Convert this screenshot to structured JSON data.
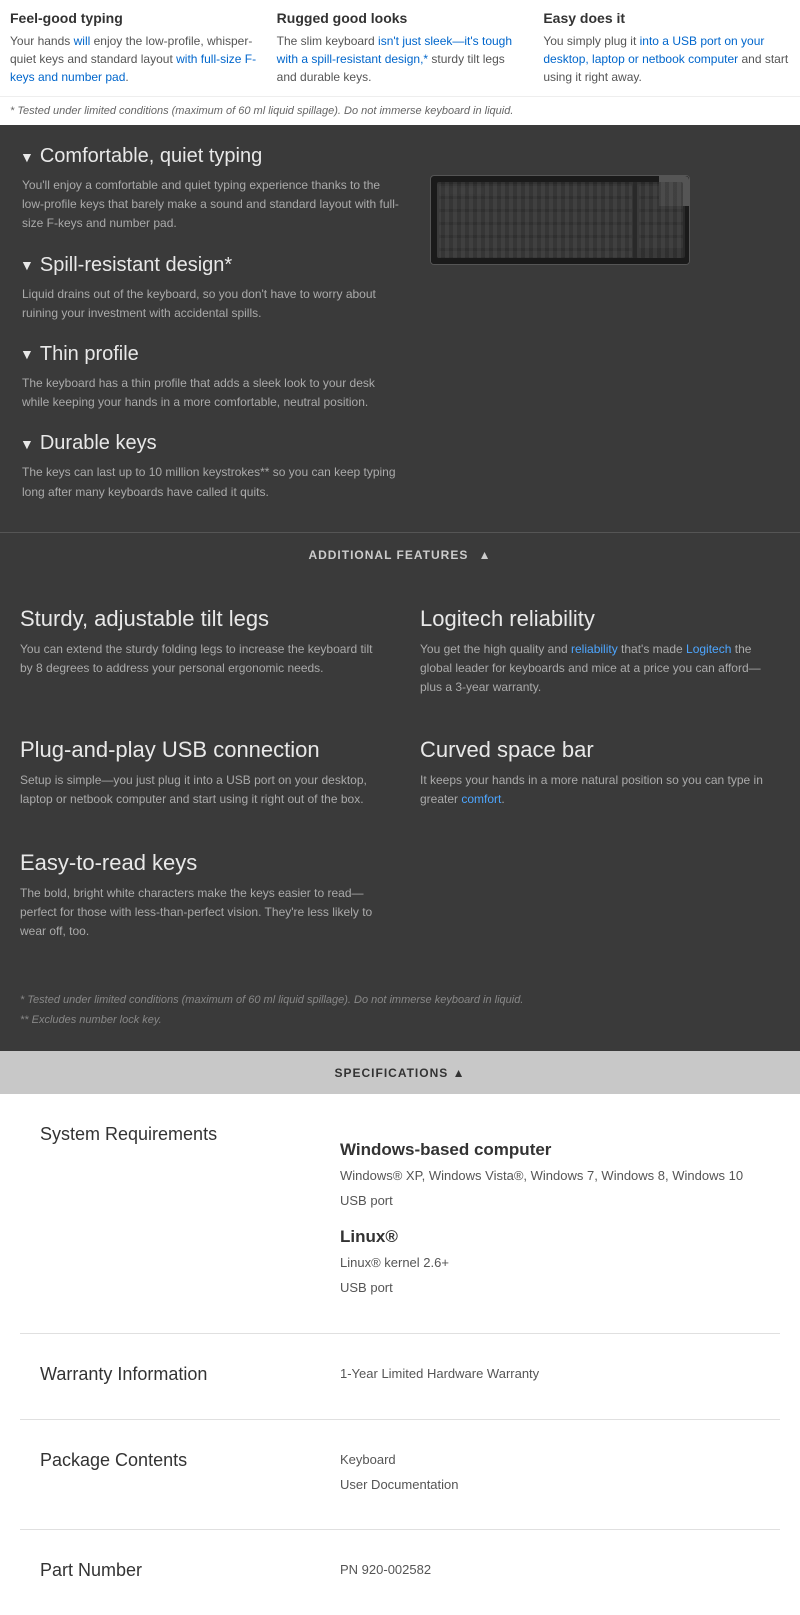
{
  "top_features": [
    {
      "title": "Feel-good typing",
      "description": "Your hands will enjoy the low-profile, whisper-quiet keys and standard layout with full-size F-keys and number pad.",
      "highlighted": [
        "will",
        "with full-size F-keys and number pad"
      ]
    },
    {
      "title": "Rugged good looks",
      "description": "The slim keyboard isn't just sleek—it's tough with a spill-resistant design,* sturdy tilt legs and durable keys.",
      "highlighted": [
        "isn't just sleek—it's tough with a spill-resistant design,*"
      ]
    },
    {
      "title": "Easy does it",
      "description": "You simply plug it into a USB port on your desktop, laptop or netbook computer and start using it right away.",
      "highlighted": [
        "into a USB port on your desktop, laptop or netbook computer"
      ]
    }
  ],
  "footnote_top": "* Tested under limited conditions (maximum of 60 ml liquid spillage). Do not immerse keyboard in liquid.",
  "dark_features": [
    {
      "title": "Comfortable, quiet typing",
      "description": "You'll enjoy a comfortable and quiet typing experience thanks to the low-profile keys that barely make a sound and standard layout with full-size F-keys and number pad."
    },
    {
      "title": "Spill-resistant design*",
      "description": "Liquid drains out of the keyboard, so you don't have to worry about ruining your investment with accidental spills."
    },
    {
      "title": "Thin profile",
      "description": "The keyboard has a thin profile that adds a sleek look to your desk while keeping your hands in a more comfortable, neutral position."
    },
    {
      "title": "Durable keys",
      "description": "The keys can last up to 10 million keystrokes** so you can keep typing long after many keyboards have called it quits."
    }
  ],
  "additional_features_label": "ADDITIONAL FEATURES",
  "additional_features": [
    {
      "title": "Sturdy, adjustable tilt legs",
      "description": "You can extend the sturdy folding legs to increase the keyboard tilt by 8 degrees to address your personal ergonomic needs."
    },
    {
      "title": "Logitech reliability",
      "description": "You get the high quality and reliability that's made Logitech the global leader for keyboards and mice at a price you can afford—plus a 3-year warranty."
    },
    {
      "title": "Plug-and-play USB connection",
      "description": "Setup is simple—you just plug it into a USB port on your desktop, laptop or netbook computer and start using it right out of the box."
    },
    {
      "title": "Curved space bar",
      "description": "It keeps your hands in a more natural position so you can type in greater comfort.",
      "highlighted": [
        "comfort"
      ]
    },
    {
      "title": "Easy-to-read keys",
      "description": "The bold, bright white characters make the keys easier to read—perfect for those with less-than-perfect vision. They're less likely to wear off, too."
    }
  ],
  "dark_footnotes": [
    "* Tested under limited conditions (maximum of 60 ml liquid spillage). Do not immerse keyboard in liquid.",
    "** Excludes number lock key."
  ],
  "specifications_label": "SPECIFICATIONS",
  "specs": [
    {
      "label": "System Requirements",
      "sub_sections": [
        {
          "heading": "Windows-based computer",
          "lines": [
            "Windows® XP, Windows Vista®, Windows 7, Windows 8, Windows 10",
            "USB port"
          ]
        },
        {
          "heading": "Linux®",
          "lines": [
            "Linux® kernel 2.6+",
            "USB port"
          ]
        }
      ]
    },
    {
      "label": "Warranty Information",
      "lines": [
        "1-Year Limited Hardware Warranty"
      ]
    },
    {
      "label": "Package Contents",
      "lines": [
        "Keyboard",
        "User Documentation"
      ]
    },
    {
      "label": "Part Number",
      "lines": [
        "PN 920-002582"
      ]
    }
  ]
}
